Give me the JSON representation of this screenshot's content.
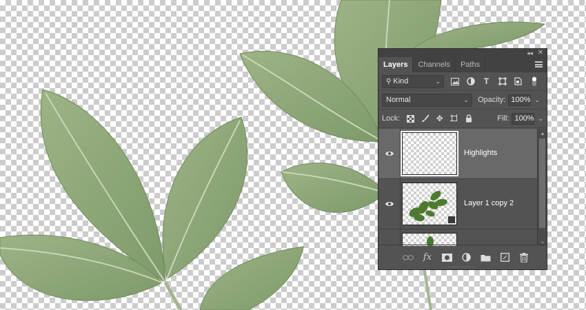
{
  "canvas": {
    "leaf_color": "#8fa87a",
    "leaf_vein_color": "#c9d6b8",
    "stem_color": "#a3b58f"
  },
  "panel": {
    "collapse_icon": "double-chevron-left-icon",
    "close_icon": "close-icon",
    "tabs": [
      {
        "label": "Layers",
        "active": true
      },
      {
        "label": "Channels",
        "active": false
      },
      {
        "label": "Paths",
        "active": false
      }
    ],
    "menu_icon": "panel-menu-icon",
    "filter": {
      "kind_label": "Kind",
      "icons": [
        "pixel-filter-icon",
        "adjustment-filter-icon",
        "type-filter-icon",
        "shape-filter-icon",
        "smart-object-filter-icon",
        "filter-toggle-icon"
      ]
    },
    "blend": {
      "mode": "Normal",
      "opacity_label": "Opacity:",
      "opacity_value": "100%"
    },
    "lock": {
      "label": "Lock:",
      "icons": [
        "lock-transparent-icon",
        "lock-pixels-icon",
        "lock-position-icon",
        "lock-artboard-icon",
        "lock-all-icon"
      ],
      "fill_label": "Fill:",
      "fill_value": "100%"
    },
    "layers": [
      {
        "name": "Highlights",
        "visible": true,
        "selected": true
      },
      {
        "name": "Layer 1 copy 2",
        "visible": true,
        "selected": false
      },
      {
        "name": "",
        "visible": false,
        "selected": false
      }
    ],
    "bottom_icons": [
      "link-layers-icon",
      "fx-icon",
      "layer-mask-icon",
      "adjustment-layer-icon",
      "group-folder-icon",
      "new-layer-icon",
      "trash-icon"
    ]
  }
}
